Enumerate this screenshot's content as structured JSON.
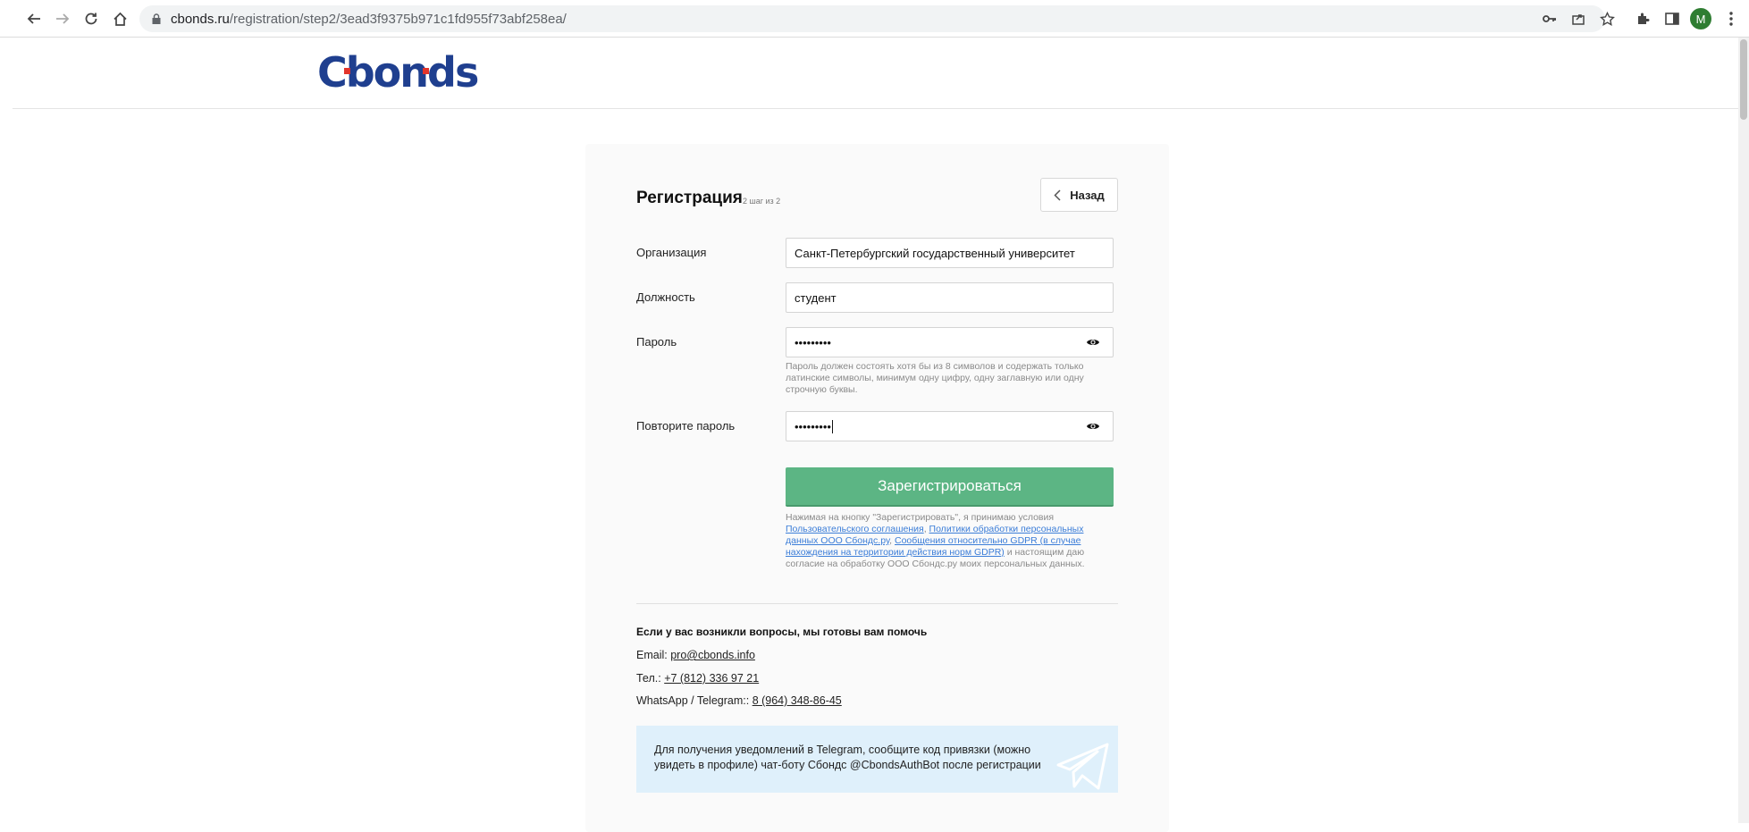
{
  "browser": {
    "url_host": "cbonds.ru",
    "url_path": "/registration/step2/3ead3f9375b971c1fd955f73abf258ea/",
    "profile_initial": "M"
  },
  "logo": {
    "text": "Cbonds"
  },
  "form": {
    "title": "Регистрация",
    "step": "2 шаг из 2",
    "back_label": "Назад",
    "organization_label": "Организация",
    "organization_value": "Санкт-Петербургский государственный университет",
    "position_label": "Должность",
    "position_value": "студент",
    "password_label": "Пароль",
    "password_value": "•••••••••",
    "password_hint": "Пароль должен состоять хотя бы из 8 символов и содержать только латинские символы, минимум одну цифру, одну заглавную или одну строчную буквы.",
    "repeat_label": "Повторите пароль",
    "repeat_value": "•••••••••",
    "submit_label": "Зарегистрироваться",
    "terms_prefix": "Нажимая на кнопку \"Зарегистрировать\", я принимаю условия",
    "terms_link1": "Пользовательского соглашения",
    "terms_sep1": ", ",
    "terms_link2": "Политики обработки персональных данных ООО Сбондс.ру",
    "terms_sep2": ", ",
    "terms_link3": "Сообщения относительно GDPR (в случае нахождения на территории действия норм GDPR)",
    "terms_suffix": " и настоящим даю согласие на обработку ООО Сбондс.ру моих персональных данных."
  },
  "help": {
    "title": "Если у вас возникли вопросы, мы готовы вам помочь",
    "email_label": "Email: ",
    "email_value": "pro@cbonds.info",
    "phone_label": "Тел.: ",
    "phone_value": "+7 (812) 336 97 21",
    "messenger_label": "WhatsApp / Telegram:: ",
    "messenger_value": "8 (964) 348-86-45",
    "telegram_note": "Для получения уведомлений в Telegram, сообщите код привязки (можно увидеть в профиле) чат-боту Сбондс @CbondsAuthBot после регистрации"
  },
  "colors": {
    "brand_blue": "#1f3f8f",
    "brand_red": "#e2342b",
    "submit_green": "#5cb584"
  }
}
